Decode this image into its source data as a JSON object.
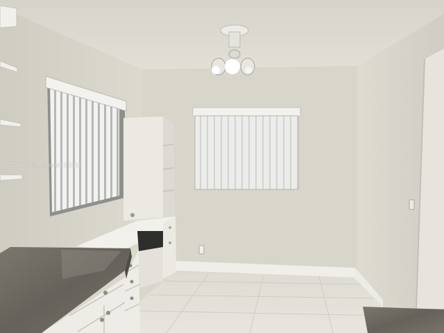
{
  "watermark": {
    "text": "A11818338 © Miami MLS 2025"
  },
  "palette": {
    "wall": "#d8d5ca",
    "ceiling": "#dedbd2",
    "floor": "#e3e0d8",
    "cabinet": "#eeece6",
    "countertop": "#6e6a62",
    "blinds": "#f1f1ef"
  },
  "icons": [
    "ceiling-fan-icon",
    "light-bulb-icon",
    "electrical-outlet-icon",
    "light-switch-icon"
  ]
}
